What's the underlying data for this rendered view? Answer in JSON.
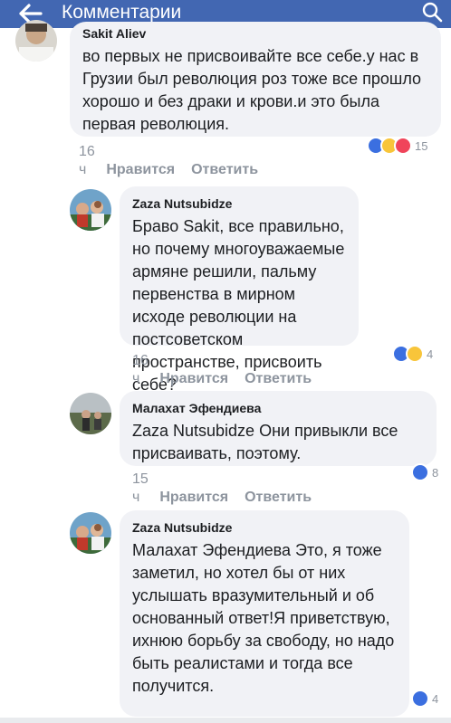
{
  "header": {
    "title": "Комментарии",
    "bg_color": "#4267b2",
    "back_icon": "arrow-left-icon",
    "search_icon": "search-icon"
  },
  "comments": [
    {
      "author": "Sakit Aliev",
      "text": "во первых не присвоивайте все себе.у нас в Грузии был революция роз тоже все прошло хорошо и без драки и крови.и это была первая революция.",
      "time": "16 ч",
      "like_label": "Нравится",
      "reply_label": "Ответить",
      "reactions": [
        "like",
        "haha",
        "love"
      ],
      "reaction_count": "15"
    },
    {
      "author": "Zaza Nutsubidze",
      "text": "Браво Sakit, все правильно, но почему многоуважаемые армяне решили, пальму первенства в мирном исходе революции на постсоветском пространстве, присвоить себе?",
      "time": "16 ч",
      "like_label": "Нравится",
      "reply_label": "Ответить",
      "reactions": [
        "like",
        "haha"
      ],
      "reaction_count": "4"
    },
    {
      "author": "Малахат Эфендиева",
      "text": "Zaza Nutsubidze Они привыкли все присваивать, поэтому.",
      "time": "15 ч",
      "like_label": "Нравится",
      "reply_label": "Ответить",
      "reactions": [
        "like"
      ],
      "reaction_count": "8"
    },
    {
      "author": "Zaza Nutsubidze",
      "text": "Малахат Эфендиева Это, я тоже заметил, но хотел бы от них услышать вразумительный и об основанный ответ!Я приветствую, ихнюю борьбу за свободу, но надо быть реалистами и тогда все получится.",
      "reactions": [
        "like"
      ],
      "reaction_count": "4"
    }
  ]
}
